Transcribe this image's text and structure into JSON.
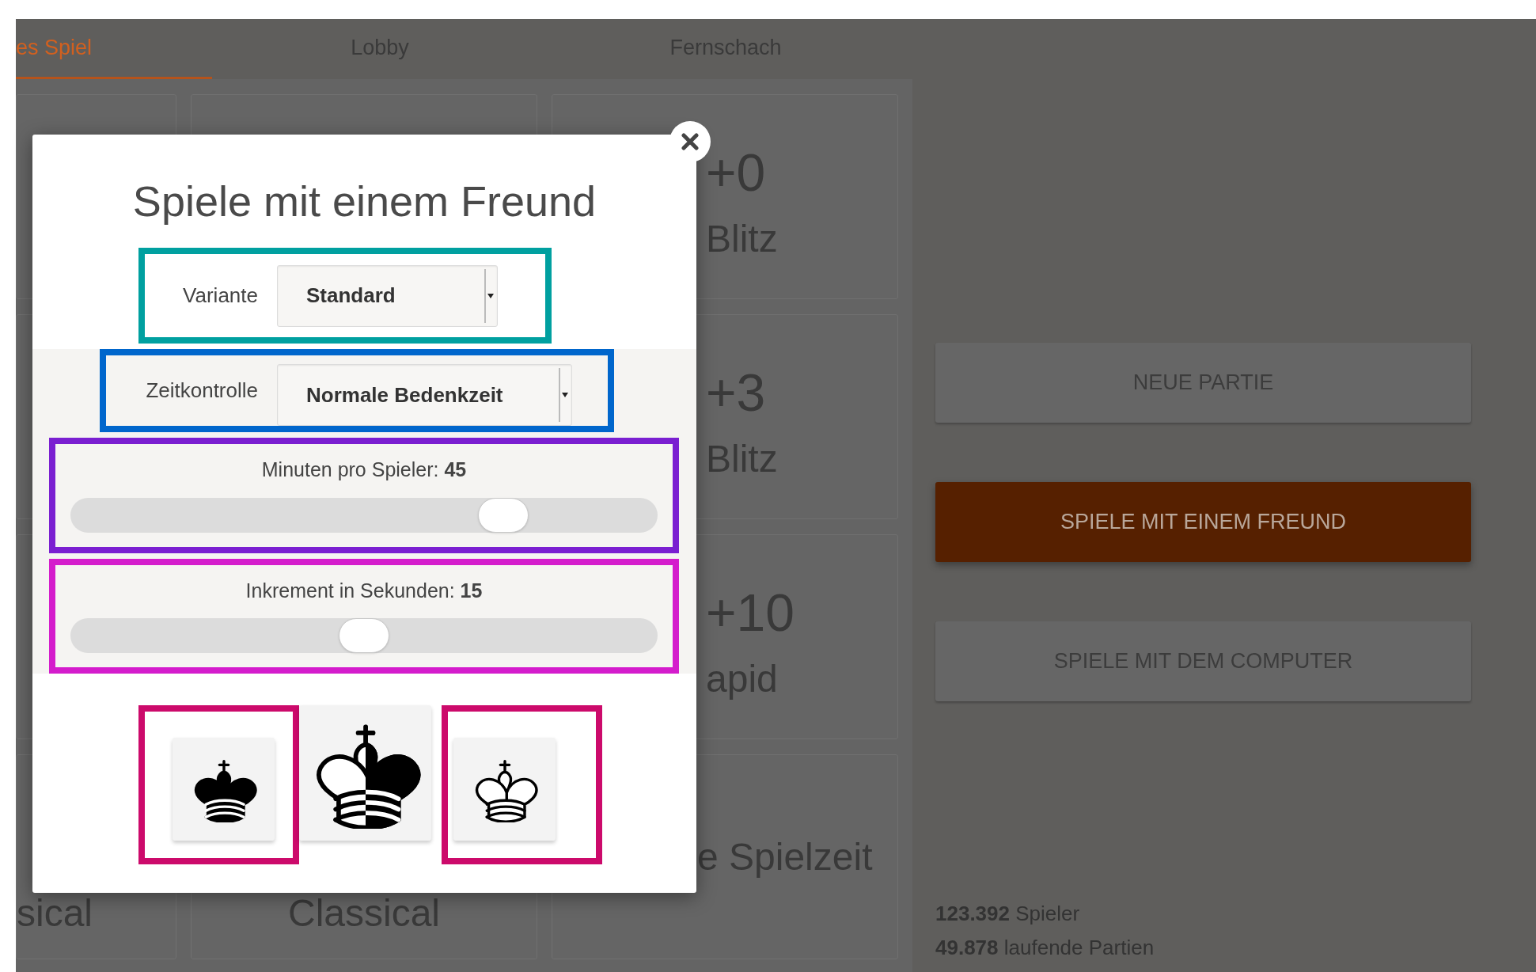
{
  "tabs": [
    {
      "label": "es Spiel",
      "selected": true
    },
    {
      "label": "Lobby",
      "selected": false
    },
    {
      "label": "Fernschach",
      "selected": false
    }
  ],
  "game_grid": {
    "cards": [
      {
        "time": "+0",
        "label": "Blitz"
      },
      {
        "time": "+3",
        "label": "Blitz"
      },
      {
        "time": "+10",
        "label": "apid"
      },
      {
        "label": "sical"
      },
      {
        "label": "Classical"
      },
      {
        "label": "e Spielzeit"
      }
    ]
  },
  "dialog": {
    "title": "Spiele mit einem Freund",
    "variant": {
      "label": "Variante",
      "value": "Standard"
    },
    "time_control": {
      "label": "Zeitkontrolle",
      "value": "Normale Bedenkzeit"
    },
    "sliders": [
      {
        "label": "Minuten pro Spieler:",
        "value": "45",
        "level": 0.76
      },
      {
        "label": "Inkrement in Sekunden:",
        "value": "15",
        "level": 0.5
      }
    ],
    "color_buttons": [
      {
        "kind": "black"
      },
      {
        "kind": "random"
      },
      {
        "kind": "white"
      }
    ]
  },
  "actions": [
    {
      "label": "NEUE PARTIE",
      "primary": false
    },
    {
      "label": "SPIELE MIT EINEM FREUND",
      "primary": true
    },
    {
      "label": "SPIELE MIT DEM COMPUTER",
      "primary": false
    }
  ],
  "stats": [
    "**123.392** Spieler",
    "**49.878** laufende Partien"
  ]
}
